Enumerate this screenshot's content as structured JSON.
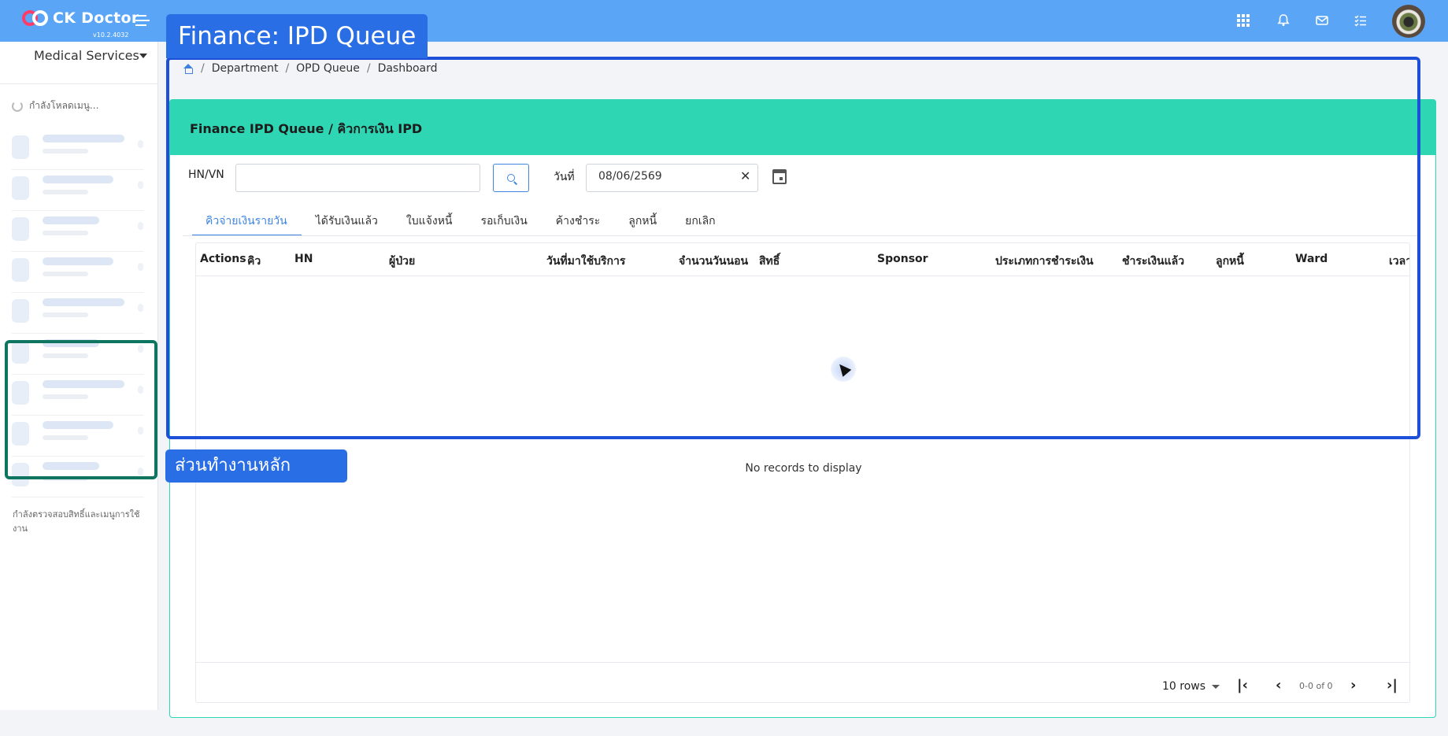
{
  "app": {
    "name": "CK Doctor",
    "version": "v10.2.4032"
  },
  "sidebar": {
    "title": "Medical Services",
    "loading_text": "กำลังโหลดเมนู...",
    "footer_text": "กำลังตรวจสอบสิทธิ์และเมนูการใช้งาน"
  },
  "annotations": {
    "page_tag": "Finance: IPD Queue",
    "work_area_tag": "ส่วนทำงานหลัก"
  },
  "breadcrumb": [
    "Department",
    "OPD Queue",
    "Dashboard"
  ],
  "card": {
    "title": "Finance IPD Queue / คิวการเงิน IPD"
  },
  "filters": {
    "hn_label": "HN/VN",
    "hn_value": "",
    "date_label": "วันที่",
    "date_value": "08/06/2569"
  },
  "tabs": [
    "คิวจ่ายเงินรายวัน",
    "ได้รับเงินแล้ว",
    "ใบแจ้งหนี้",
    "รอเก็บเงิน",
    "ค้างชำระ",
    "ลูกหนี้",
    "ยกเลิก"
  ],
  "table": {
    "columns": [
      "Actions",
      "คิว",
      "HN",
      "ผู้ป่วย",
      "วันที่มาใช้บริการ",
      "จำนวนวันนอน",
      "สิทธิ์",
      "Sponsor",
      "ประเภทการชำระเงิน",
      "ชำระเงินแล้ว",
      "ลูกหนี้",
      "Ward",
      "เวลา"
    ],
    "empty_message": "No records to display"
  },
  "pagination": {
    "rows_per_page": "10 rows",
    "info": "0-0 of 0"
  },
  "colors": {
    "topbar": "#5aa5f5",
    "card_header": "#2fd6b4",
    "accent": "#3f86e0",
    "annotation_main": "#1d4fd9",
    "annotation_sidebar": "#0e7561"
  }
}
